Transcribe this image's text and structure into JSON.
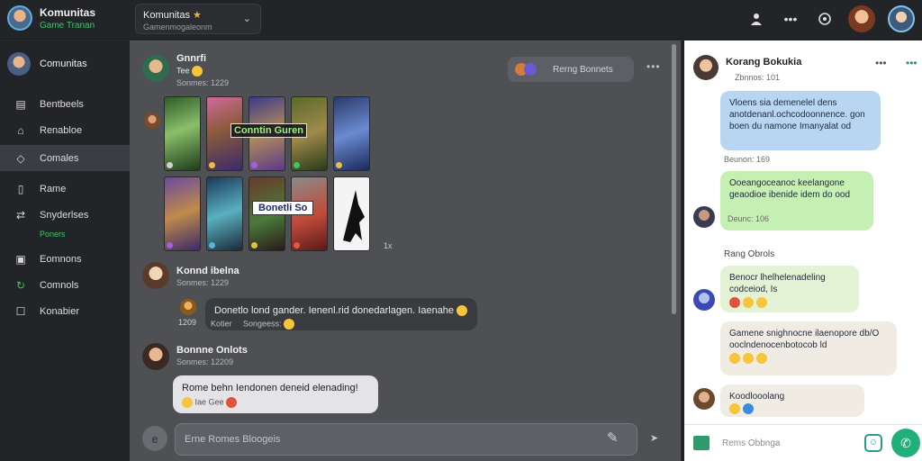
{
  "app": {
    "title": "Komunitas",
    "subtitle": "Game Tranan"
  },
  "server_select": {
    "name": "Komunitas",
    "sub": "Gamenmogaleonm"
  },
  "sidebar": {
    "header": "Comunitas",
    "items": [
      {
        "label": "Bentbeels",
        "icon": "document-icon"
      },
      {
        "label": "Renabloe",
        "icon": "bell-icon"
      },
      {
        "label": "Comales",
        "icon": "home-icon",
        "active": true
      },
      {
        "label": "Rame",
        "icon": "bookmark-icon"
      },
      {
        "label": "Snyderlses",
        "icon": "share-icon",
        "sub": "Poners"
      },
      {
        "label": "Eomnons",
        "icon": "image-icon"
      },
      {
        "label": "Comnols",
        "icon": "refresh-icon"
      },
      {
        "label": "Konabier",
        "icon": "square-icon"
      }
    ]
  },
  "chat": {
    "pill_text": "Rerng Bonnets",
    "post1": {
      "name": "Gnnrfi",
      "sub": "Tee",
      "time": "Sonmes: 1229"
    },
    "card_label_1": "Conntin Guren",
    "card_label_2": "Bonetli So",
    "card_count": "1x",
    "msg2": {
      "name": "Konnd ibelna",
      "time": "Sonmes: 1229",
      "text": "Donetlo lond gander. Ienenl.rid donedarlagen. Iaenahe",
      "reply_time": "1209",
      "reply_text": "Kotier",
      "reply_text2": "Songeess:"
    },
    "msg3": {
      "name": "Bonnne Onlots",
      "time": "Sonmes: 12209",
      "text": "Rome behn Iendonen deneid elenading!",
      "reactions": "Iae Gee"
    },
    "composer_placeholder": "Erne Romes Bloogeis"
  },
  "right_panel": {
    "title": "Korang Bokukia",
    "sub": "Zbnnos: 101",
    "messages": [
      {
        "text": "Vloens sia demenelel dens anotdenanl.ochcodoonnence. gon boen du namone Imanyalat od",
        "time": "Beunon: 169"
      },
      {
        "text": "Ooeangoceanoc keelangone geaodioe ibenide idem do ood",
        "time": "Deunc: 106"
      },
      {
        "sender": "Rang Obrols",
        "text": "Benocr lhelhelenadeling codceiod, Is",
        "time": ""
      },
      {
        "text": "Gamene snighnocne ilaenopore db/O ooclndenocenbotocob ld",
        "time": ""
      },
      {
        "text": "Koodlooolang",
        "time": ""
      }
    ],
    "composer_placeholder": "Rems Obbnga"
  },
  "colors": {
    "accent_green": "#21b07a",
    "status_green": "#3fc46a",
    "chat_bg": "#4f5054",
    "sidebar_bg": "#232428"
  }
}
